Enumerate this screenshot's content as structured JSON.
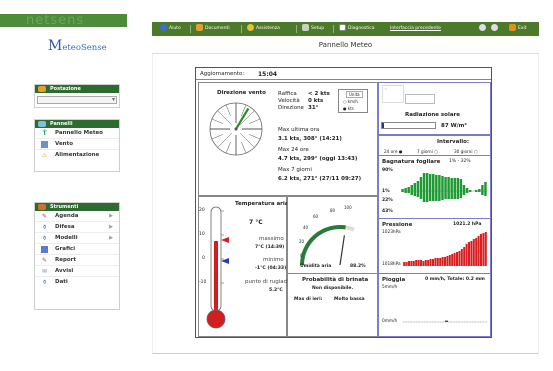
{
  "brand": "netsens",
  "logo": {
    "big": "M",
    "rest": "eteoSense"
  },
  "sidebar": {
    "postazione": {
      "header": "Postazione"
    },
    "pannelli": {
      "header": "Pannelli",
      "items": [
        {
          "label": "Pannello Meteo",
          "icon": "sensor-icon"
        },
        {
          "label": "Vento",
          "icon": "wind-icon"
        },
        {
          "label": "Alimentazione",
          "icon": "warning-icon"
        }
      ]
    },
    "strumenti": {
      "header": "Strumenti",
      "items": [
        {
          "label": "Agenda",
          "icon": "agenda-icon"
        },
        {
          "label": "Difesa",
          "icon": "defense-icon"
        },
        {
          "label": "Modelli",
          "icon": "models-icon"
        },
        {
          "label": "Grafici",
          "icon": "charts-icon"
        },
        {
          "label": "Report",
          "icon": "report-icon"
        },
        {
          "label": "Avvisi",
          "icon": "alert-icon"
        },
        {
          "label": "Dati",
          "icon": "data-icon"
        }
      ]
    }
  },
  "toolbar": {
    "aiuto": "Aiuto",
    "documenti": "Documenti",
    "assistenza": "Assistenza",
    "setup": "Setup",
    "diagnostica": "Diagnostica",
    "interfaccia": "Interfaccia precedente",
    "exit": "Exit"
  },
  "page_title": "Pannello Meteo",
  "panel": {
    "aggiornamento_label": "Aggiornamento:",
    "aggiornamento_time": "15:04",
    "wind": {
      "title": "Direzione vento",
      "raffica_label": "Raffica",
      "raffica_val": "< 2 kts",
      "velocita_label": "Velocità",
      "velocita_val": "0 kts",
      "direzione_label": "Direzione",
      "direzione_val": "31°",
      "units_label": "Unità",
      "unit_kmh": "km/h",
      "unit_kts": "kts",
      "max_ora_label": "Max ultima ora",
      "max_ora_val": "3.1 kts, 308° (14:21)",
      "max_24_label": "Max 24 ore",
      "max_24_val": "4.7 kts, 299° (oggi 13:43)",
      "max_7_label": "Max 7 giorni",
      "max_7_val": "6.2 kts, 271° (27/11 09:27)",
      "direction_deg": 31
    },
    "radiation": {
      "title": "Radiazione solare",
      "value": "87 W/m²",
      "fill": 0.03
    },
    "interval": {
      "title": "Intervallo:",
      "opt1": "24 ore",
      "opt2": "7 giorni",
      "opt3": "30 giorni"
    },
    "leaf": {
      "title": "Bagnatura fogliare",
      "range": "1% - 32%",
      "t90": "90%",
      "t1": "1%",
      "t22": "22%",
      "t43": "43%"
    },
    "pressure": {
      "title": "Pressione",
      "value": "1021.2 hPa",
      "top": "1023hPa",
      "bottom": "1018hPa"
    },
    "rain": {
      "title": "Pioggia",
      "value": "0 mm/h, Totale: 0.2 mm",
      "top": "5mm/h",
      "bottom": "0mm/h"
    },
    "temperature": {
      "title": "Temperatura aria",
      "value": "7 °C",
      "massimo_label": "massimo",
      "massimo_val": "7°C (14:39)",
      "minimo_label": "minimo",
      "minimo_val": "-1°C (04:33)",
      "rugiada_label": "punto di rugiada",
      "rugiada_val": "5.2°C",
      "scale": [
        "20",
        "10",
        "0",
        "-10"
      ]
    },
    "humidity": {
      "title": "Umidità aria",
      "value": "88.2%",
      "scale": [
        "0",
        "20",
        "40",
        "60",
        "80",
        "100"
      ],
      "percent": 88.2
    },
    "brina": {
      "title": "Probabilità di brinata",
      "status": "Non disponibile.",
      "max_label": "Max di ieri:",
      "max_val": "Molto bassa"
    }
  }
}
